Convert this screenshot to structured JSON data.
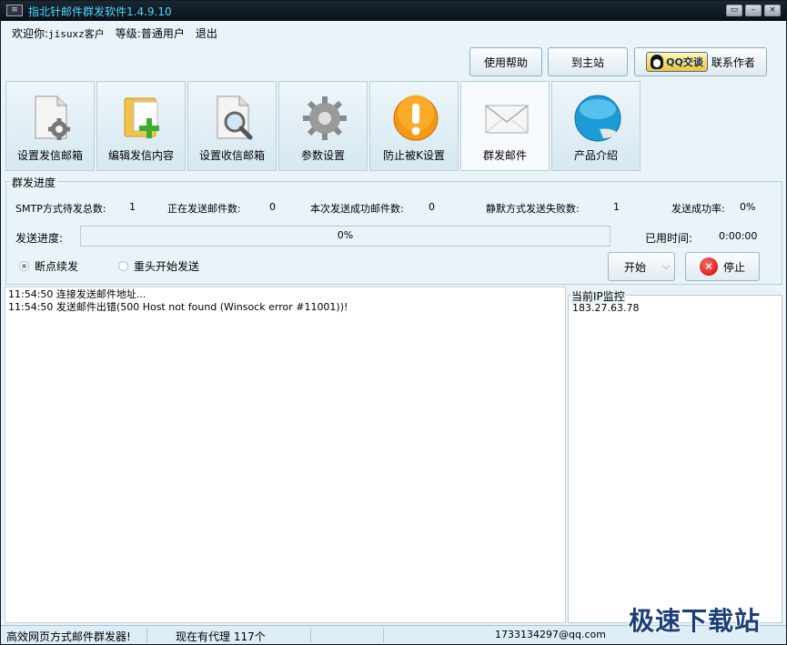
{
  "window": {
    "title": "指北针邮件群发软件1.4.9.10",
    "sys_icon": "≡"
  },
  "window_buttons": {
    "restore": "▭",
    "minimize": "–",
    "close": "×"
  },
  "header": {
    "welcome": "欢迎你:",
    "username": "jisuxz客户",
    "level_label": "等级:",
    "level": "普通用户",
    "logout": "退出"
  },
  "top_buttons": {
    "help": "使用帮助",
    "home": "到主站",
    "qq_badge": "QQ交谈",
    "contact": "联系作者"
  },
  "tabs": [
    {
      "label": "设置发信邮箱",
      "icon": "document-gear-icon"
    },
    {
      "label": "编辑发信内容",
      "icon": "folder-add-icon"
    },
    {
      "label": "设置收信邮箱",
      "icon": "document-search-icon"
    },
    {
      "label": "参数设置",
      "icon": "gear-icon"
    },
    {
      "label": "防止被K设置",
      "icon": "warning-icon"
    },
    {
      "label": "群发邮件",
      "icon": "envelope-icon"
    },
    {
      "label": "产品介绍",
      "icon": "new-badge-icon"
    }
  ],
  "active_tab": "群发邮件",
  "progress_group": {
    "title": "群发进度",
    "smtp_pending_label": "SMTP方式待发总数:",
    "smtp_pending": "1",
    "sending_label": "正在发送邮件数:",
    "sending": "0",
    "success_label": "本次发送成功邮件数:",
    "success": "0",
    "silent_fail_label": "静默方式发送失败数:",
    "silent_fail": "1",
    "rate_label": "发送成功率:",
    "rate": "0%",
    "progress_label": "发送进度:",
    "progress_text": "0%",
    "progress_value": 0,
    "elapsed_label": "已用时间:",
    "elapsed": "0:00:00",
    "resume_option": "断点续发",
    "restart_option": "重头开始发送",
    "start_button": "开始",
    "stop_button": "停止",
    "stop_glyph": "✕"
  },
  "log": [
    {
      "time": "11:54:50",
      "text": "连接发送邮件地址..."
    },
    {
      "time": "11:54:50",
      "text": "发送邮件出错(500 Host not found (Winsock error #11001))!"
    }
  ],
  "ip_monitor": {
    "title": "当前IP监控",
    "ip": "183.27.63.78"
  },
  "status_bar": {
    "slogan": "高效网页方式邮件群发器!",
    "proxy": "现在有代理 117个",
    "email": "1733134297@qq.com"
  },
  "watermark": "极速下载站"
}
